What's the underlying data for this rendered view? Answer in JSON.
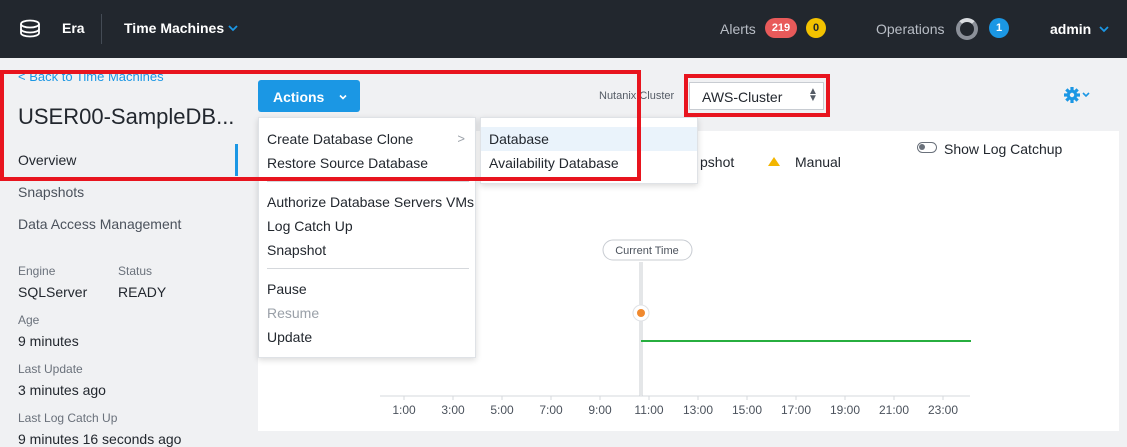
{
  "topbar": {
    "brand": "Era",
    "time_machines": "Time Machines",
    "alerts_label": "Alerts",
    "alerts_critical": "219",
    "alerts_warning": "0",
    "operations_label": "Operations",
    "operations_count": "1",
    "user": "admin"
  },
  "sidebar": {
    "back_link": "< Back to Time Machines",
    "title": "USER00-SampleDB...",
    "nav": [
      "Overview",
      "Snapshots",
      "Data Access Management"
    ],
    "active_nav": "Overview",
    "engine_label": "Engine",
    "engine_value": "SQLServer",
    "status_label": "Status",
    "status_value": "READY",
    "age_label": "Age",
    "age_value": "9 minutes",
    "last_update_label": "Last Update",
    "last_update_value": "3 minutes ago",
    "last_log_label": "Last Log Catch Up",
    "last_log_value": "9 minutes 16 seconds ago"
  },
  "toolbar": {
    "actions_label": "Actions",
    "cluster_label": "Nutanix Cluster",
    "cluster_value": "AWS-Cluster"
  },
  "actions_menu": {
    "group1": [
      "Create Database Clone",
      "Restore Source Database"
    ],
    "group2": [
      "Authorize Database Servers VMs",
      "Log Catch Up",
      "Snapshot"
    ],
    "group3": [
      "Pause",
      "Resume",
      "Update"
    ],
    "disabled": [
      "Resume"
    ],
    "submenu_arrow": ">"
  },
  "clone_submenu": {
    "items": [
      "Database",
      "Availability Database"
    ],
    "highlighted": "Database"
  },
  "timeline": {
    "show_log_catchup_label": "Show Log Catchup",
    "legend": [
      "pshot",
      "Manual"
    ],
    "current_time_label": "Current Time",
    "ticks": [
      "1:00",
      "3:00",
      "5:00",
      "7:00",
      "9:00",
      "11:00",
      "13:00",
      "15:00",
      "17:00",
      "19:00",
      "21:00",
      "23:00"
    ],
    "colors": {
      "continuous": "#27ae3f",
      "current_marker": "#f0892e",
      "manual": "#f3b600"
    }
  },
  "colors": {
    "accent": "#1b97e4",
    "annotation": "#e8141e",
    "topbar": "#22272e"
  }
}
